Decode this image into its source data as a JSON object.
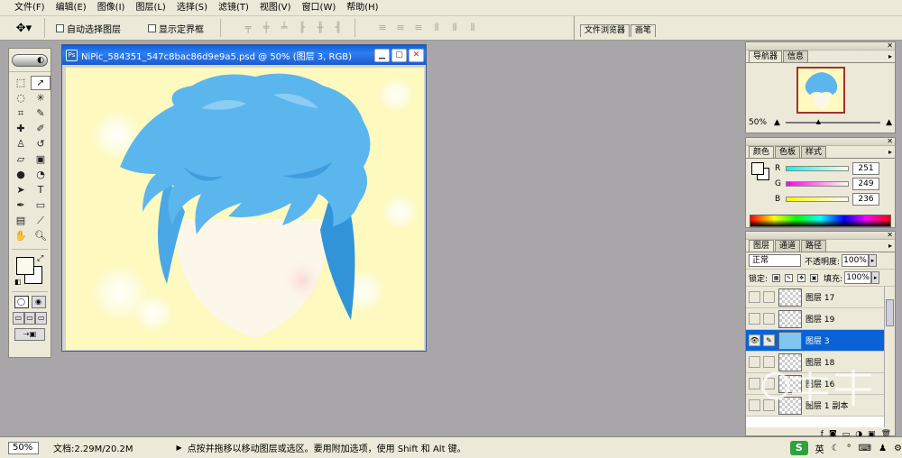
{
  "menu": [
    "文件(F)",
    "编辑(E)",
    "图像(I)",
    "图层(L)",
    "选择(S)",
    "滤镜(T)",
    "视图(V)",
    "窗口(W)",
    "帮助(H)"
  ],
  "options": {
    "auto_select": "自动选择图层",
    "show_bounds": "显示定界框",
    "well_tabs": [
      "文件浏览器",
      "画笔"
    ]
  },
  "document": {
    "title": "NiPic_584351_547c8bac86d9e9a5.psd @ 50% (图层 3, RGB)"
  },
  "navigator": {
    "tabs": [
      "导航器",
      "信息"
    ],
    "zoom": "50%"
  },
  "color": {
    "tabs": [
      "颜色",
      "色板",
      "样式"
    ],
    "r_label": "R",
    "r": "251",
    "g_label": "G",
    "g": "249",
    "b_label": "B",
    "b": "236",
    "fg_hex": "#fbf9ec"
  },
  "layers": {
    "tabs": [
      "图层",
      "通道",
      "路径"
    ],
    "blend_mode": "正常",
    "opacity_label": "不透明度:",
    "opacity": "100%",
    "lock_label": "锁定:",
    "fill_label": "填充:",
    "fill": "100%",
    "items": [
      {
        "name": "图层 17",
        "visible": false,
        "selected": false
      },
      {
        "name": "图层 19",
        "visible": false,
        "selected": false
      },
      {
        "name": "图层 3",
        "visible": true,
        "selected": true
      },
      {
        "name": "图层 18",
        "visible": false,
        "selected": false
      },
      {
        "name": "图层 16",
        "visible": false,
        "selected": false
      },
      {
        "name": "图层 1 副本",
        "visible": false,
        "selected": false
      }
    ]
  },
  "status": {
    "zoom": "50%",
    "doc": "文档:2.29M/20.2M",
    "hint": "点按并拖移以移动图层或选区。要用附加选项，使用 Shift 和 Alt 键。",
    "ime": "英"
  },
  "colors": {
    "hair": "#5cb6ee",
    "canvas": "#fdf9bf",
    "selection": "#0a62d6"
  }
}
